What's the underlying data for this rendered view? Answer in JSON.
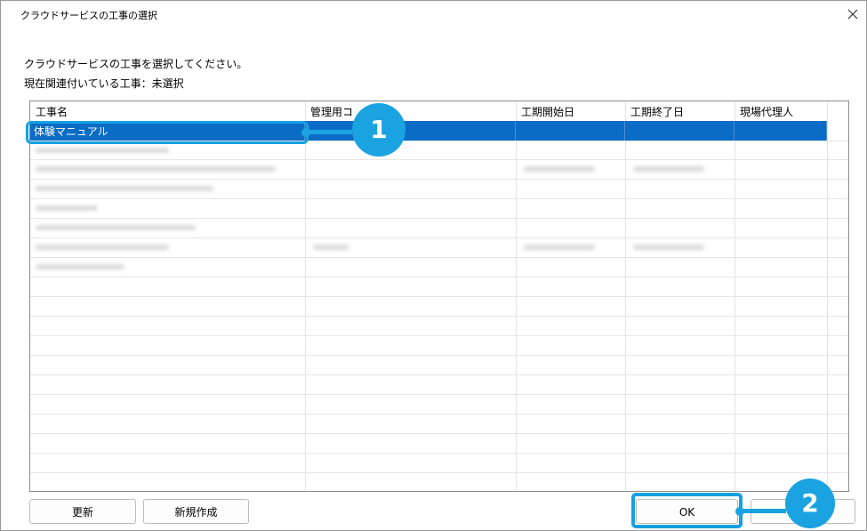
{
  "window": {
    "title": "クラウドサービスの工事の選択",
    "close_icon": "close-icon"
  },
  "instruction": "クラウドサービスの工事を選択してください。",
  "status": {
    "label": "現在関連付いている工事：",
    "value": "未選択"
  },
  "table": {
    "columns": [
      "工事名",
      "管理用コ",
      "工期開始日",
      "工期終了日",
      "現場代理人"
    ],
    "selected_row": {
      "name": "体験マニュアル"
    }
  },
  "buttons": {
    "refresh": "更新",
    "new": "新規作成",
    "ok": "OK"
  },
  "callouts": {
    "one": "1",
    "two": "2"
  },
  "colors": {
    "accent": "#1aa3e0",
    "selection": "#0a6cc4"
  }
}
